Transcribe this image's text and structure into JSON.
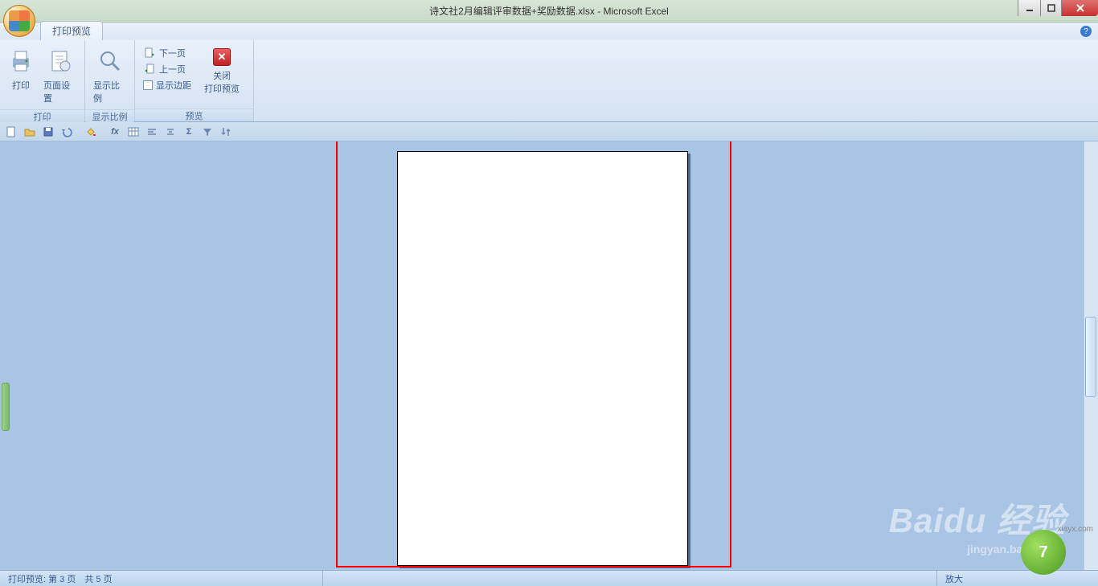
{
  "window": {
    "filename": "诗文社2月编辑评审数据+奖励数据.xlsx",
    "app": "Microsoft Excel",
    "title_sep": " - "
  },
  "tab": {
    "label": "打印预览"
  },
  "ribbon": {
    "group_print": {
      "label": "打印",
      "print_btn": "打印",
      "page_setup_btn": "页面设置"
    },
    "group_zoom": {
      "label": "显示比例",
      "zoom_btn": "显示比例"
    },
    "group_preview": {
      "label": "预览",
      "next_page": "下一页",
      "prev_page": "上一页",
      "show_margins": "显示边距",
      "close_btn_line1": "关闭",
      "close_btn_line2": "打印预览"
    }
  },
  "status": {
    "left_prefix": "打印预览: 第 ",
    "current_page": "3",
    "mid": " 页　共 ",
    "total_pages": "5",
    "suffix": " 页",
    "zoom_label": "放大"
  },
  "watermarks": {
    "baidu": "Baidu 经验",
    "baidu_sub": "jingyan.baidu.com",
    "site_text": "7号游戏",
    "site_url": "xiayx.com"
  }
}
